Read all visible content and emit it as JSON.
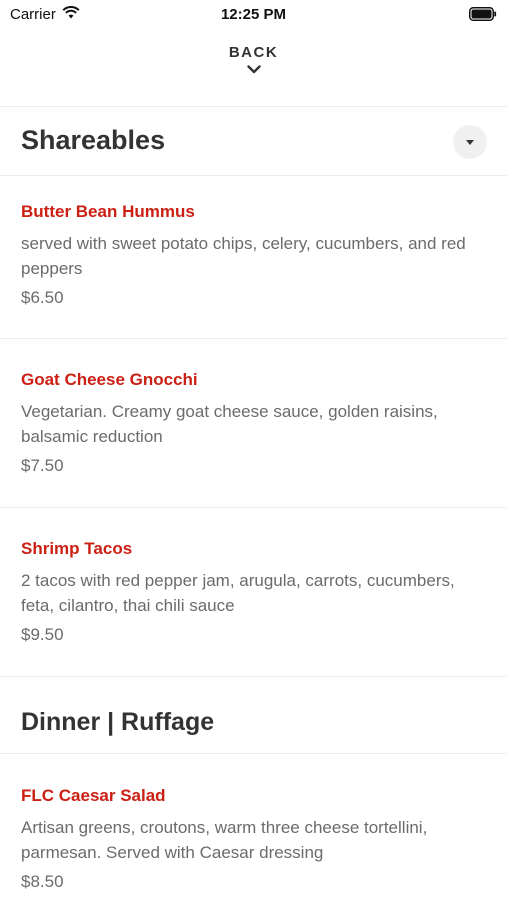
{
  "status": {
    "carrier": "Carrier",
    "time": "12:25 PM"
  },
  "nav": {
    "back_label": "BACK"
  },
  "sections": [
    {
      "title": "Shareables",
      "items": [
        {
          "name": "Butter Bean Hummus",
          "description": "served with sweet potato chips, celery, cucumbers, and red peppers",
          "price": "$6.50"
        },
        {
          "name": "Goat Cheese Gnocchi",
          "description": "Vegetarian. Creamy goat cheese sauce, golden raisins, balsamic reduction",
          "price": "$7.50"
        },
        {
          "name": "Shrimp Tacos",
          "description": "2 tacos with red pepper jam, arugula, carrots, cucumbers, feta, cilantro, thai chili sauce",
          "price": "$9.50"
        }
      ]
    },
    {
      "title": "Dinner | Ruffage",
      "items": [
        {
          "name": "FLC Caesar Salad",
          "description": "Artisan greens, croutons, warm three cheese tortellini, parmesan. Served with Caesar dressing",
          "price": "$8.50"
        }
      ]
    }
  ],
  "colors": {
    "item_name": "#cc2014",
    "text_muted": "#6b6b6b",
    "title": "#333333"
  },
  "icons": {
    "wifi": "wifi-icon",
    "battery": "battery-icon",
    "back": "chevron-down-icon",
    "toggle": "caret-down-icon"
  }
}
